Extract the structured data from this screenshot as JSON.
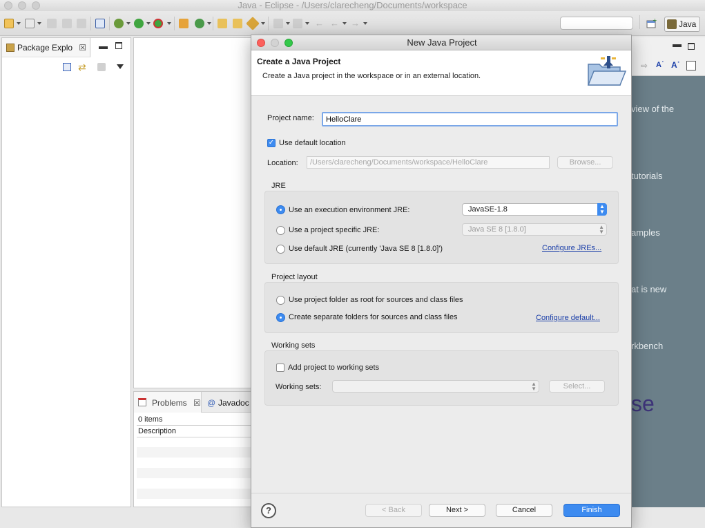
{
  "window": {
    "title": "Java - Eclipse - /Users/clarecheng/Documents/workspace",
    "perspective_label": "Java"
  },
  "package_explorer": {
    "tab_label": "Package Explo"
  },
  "problems": {
    "tab_label": "Problems",
    "javadoc_label": "Javadoc",
    "count": "0 items",
    "column": "Description"
  },
  "welcome": {
    "items": [
      "view of the",
      "tutorials",
      "amples",
      "at is new",
      "rkbench"
    ],
    "logo_fragment": "se"
  },
  "dialog": {
    "title": "New Java Project",
    "header_title": "Create a Java Project",
    "header_desc": "Create a Java project in the workspace or in an external location.",
    "project_name_label": "Project name:",
    "project_name_value": "HelloClare",
    "use_default_location_label": "Use default location",
    "use_default_location_checked": true,
    "location_label": "Location:",
    "location_value": "/Users/clarecheng/Documents/workspace/HelloClare",
    "browse_label": "Browse...",
    "jre": {
      "title": "JRE",
      "option_env": "Use an execution environment JRE:",
      "option_specific": "Use a project specific JRE:",
      "option_default": "Use default JRE (currently 'Java SE 8 [1.8.0]')",
      "env_value": "JavaSE-1.8",
      "specific_value": "Java SE 8 [1.8.0]",
      "configure_link": "Configure JREs...",
      "selected": "env"
    },
    "layout": {
      "title": "Project layout",
      "option_root": "Use project folder as root for sources and class files",
      "option_separate": "Create separate folders for sources and class files",
      "configure_link": "Configure default...",
      "selected": "separate"
    },
    "working_sets": {
      "title": "Working sets",
      "add_label": "Add project to working sets",
      "add_checked": false,
      "sets_label": "Working sets:",
      "select_label": "Select..."
    },
    "footer": {
      "help": "?",
      "back": "< Back",
      "next": "Next >",
      "cancel": "Cancel",
      "finish": "Finish"
    }
  },
  "colors": {
    "accent": "#3d8bf0",
    "welcome_bg": "#6b7f89",
    "link": "#1a3ea8"
  }
}
